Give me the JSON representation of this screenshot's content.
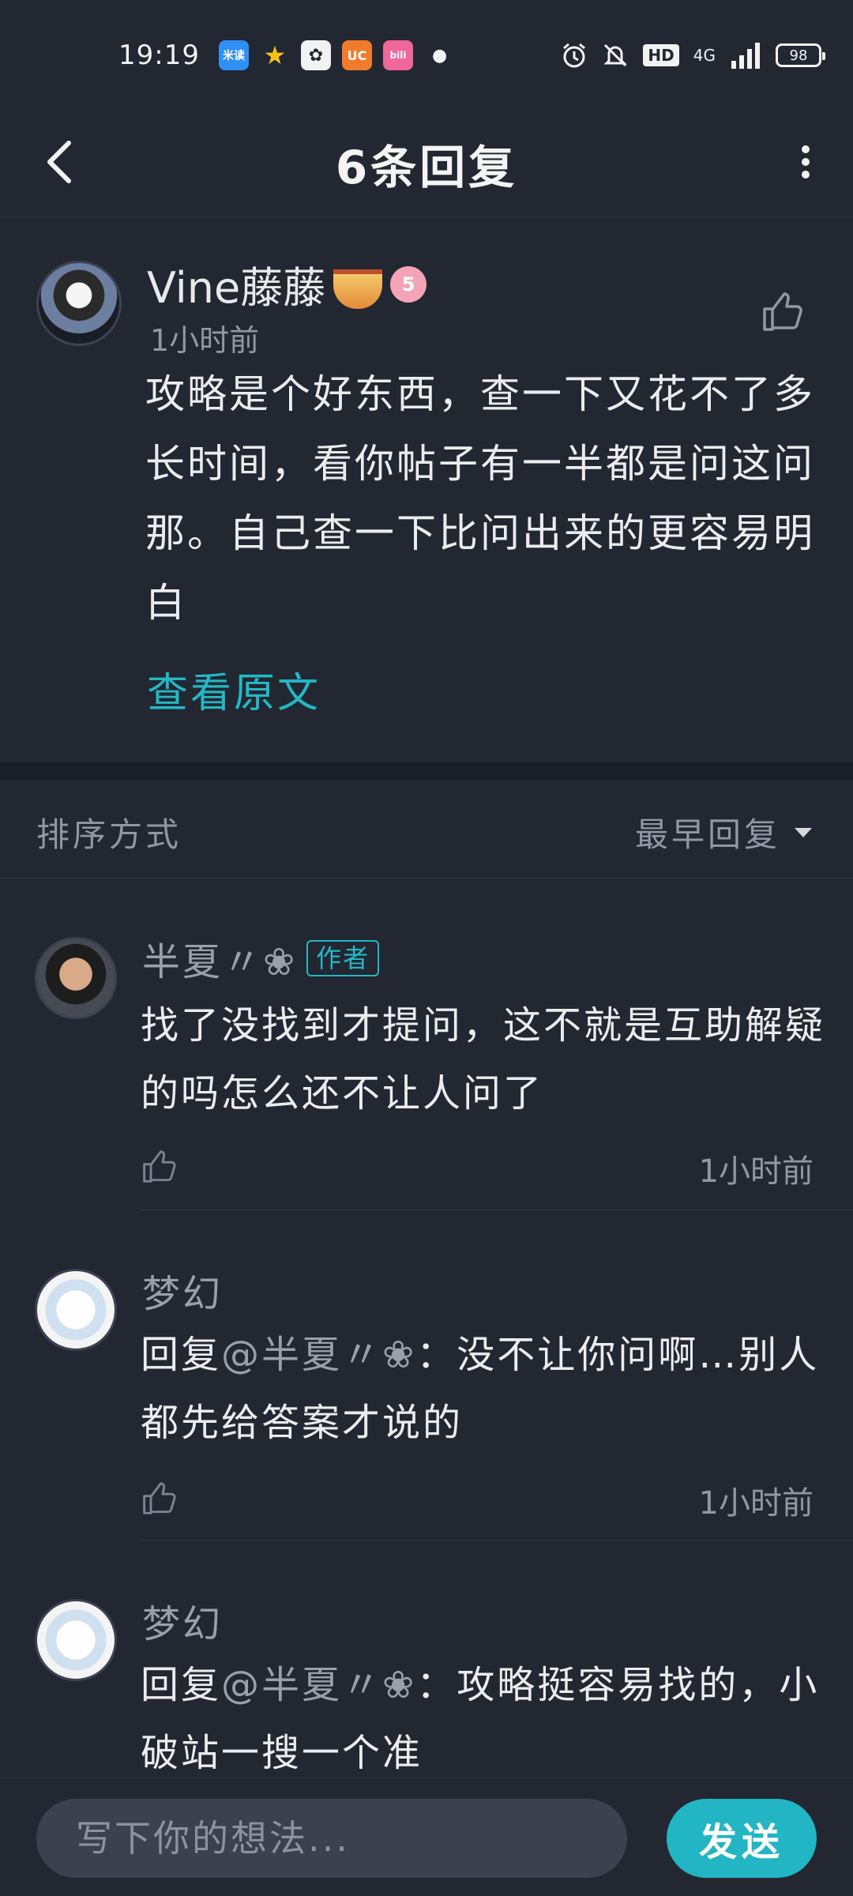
{
  "status_bar": {
    "time": "19:19",
    "app_icons": [
      {
        "name": "mimi-reader-icon",
        "label": "米读",
        "color": "#2e8ff5"
      },
      {
        "name": "star-icon",
        "label": "★",
        "color": "#f6c21a"
      },
      {
        "name": "paw-icon",
        "label": "🐾",
        "color": "#3a3a3a"
      },
      {
        "name": "uc-browser-icon",
        "label": "UC",
        "color": "#f07c2b"
      },
      {
        "name": "bilibili-icon",
        "label": "bili",
        "color": "#f0679a"
      }
    ],
    "battery": "98",
    "network": "4G",
    "hd": "HD"
  },
  "header": {
    "title": "6条回复"
  },
  "post": {
    "username": "Vine藤藤",
    "level": "5",
    "time": "1小时前",
    "content": "攻略是个好东西，查一下又花不了多长时间，看你帖子有一半都是问这问那。自己查一下比问出来的更容易明白",
    "view_original": "查看原文"
  },
  "sort": {
    "label": "排序方式",
    "selected": "最早回复"
  },
  "replies": [
    {
      "username": "半夏〃❀",
      "tag": "作者",
      "content": "找了没找到才提问，这不就是互助解疑的吗怎么还不让人问了",
      "time": "1小时前"
    },
    {
      "username": "梦幻",
      "reply_prefix": "回复",
      "mention": "@半夏〃❀",
      "content": "：没不让你问啊…别人都先给答案才说的",
      "time": "1小时前"
    },
    {
      "username": "梦幻",
      "reply_prefix": "回复",
      "mention": "@半夏〃❀",
      "content": "：攻略挺容易找的，小破站一搜一个准"
    }
  ],
  "input": {
    "placeholder": "写下你的想法...",
    "send_label": "发送"
  },
  "colors": {
    "background": "#232732",
    "accent": "#23b8c6",
    "secondary_text": "#9297a3"
  }
}
